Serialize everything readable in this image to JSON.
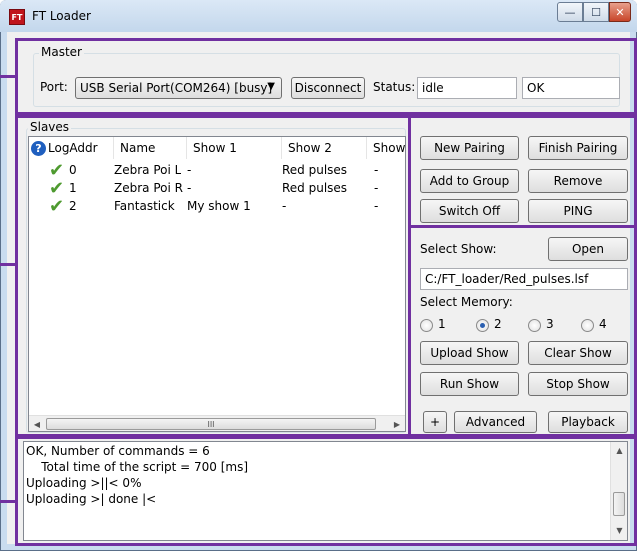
{
  "window": {
    "title": "FT Loader",
    "icon_text": "FT",
    "minimize_glyph": "—",
    "maximize_glyph": "☐",
    "close_glyph": "✕"
  },
  "master": {
    "legend": "Master",
    "port_label": "Port:",
    "port_value": "USB Serial Port(COM264) [busy]",
    "disconnect_label": "Disconnect",
    "status_label": "Status:",
    "status_value": "idle",
    "status_result": "OK"
  },
  "slaves": {
    "legend": "Slaves",
    "columns": [
      "LogAddr",
      "Name",
      "Show 1",
      "Show 2",
      "Show"
    ],
    "rows": [
      {
        "logaddr": "0",
        "name": "Zebra Poi L",
        "show1": "-",
        "show2": "Red pulses",
        "show3": "-"
      },
      {
        "logaddr": "1",
        "name": "Zebra Poi R",
        "show1": "-",
        "show2": "Red pulses",
        "show3": "-"
      },
      {
        "logaddr": "2",
        "name": "Fantastick",
        "show1": "My show 1",
        "show2": "-",
        "show3": "-"
      }
    ],
    "scroll_grip": "III"
  },
  "pairing": {
    "new_pairing": "New Pairing",
    "finish_pairing": "Finish Pairing",
    "add_to_group": "Add to Group",
    "remove": "Remove",
    "switch_off": "Switch Off",
    "ping": "PING"
  },
  "show": {
    "select_show_label": "Select Show:",
    "open_label": "Open",
    "file_path": "C:/FT_loader/Red_pulses.lsf",
    "select_memory_label": "Select Memory:",
    "memory_options": [
      "1",
      "2",
      "3",
      "4"
    ],
    "memory_selected": "2",
    "upload_show": "Upload Show",
    "clear_show": "Clear Show",
    "run_show": "Run Show",
    "stop_show": "Stop Show",
    "plus": "+",
    "advanced": "Advanced",
    "playback": "Playback"
  },
  "log": {
    "lines": [
      "OK, Number of commands = 6",
      "    Total time of the script = 700 [ms]",
      "Uploading >||< 0%",
      "Uploading >| done |<"
    ]
  },
  "colors": {
    "highlight": "#7030a0",
    "check": "#4e9a2f",
    "help_icon": "#1f5fbf"
  }
}
